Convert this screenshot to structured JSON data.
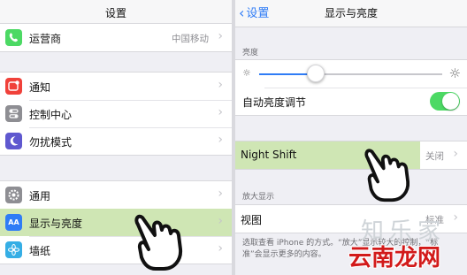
{
  "left": {
    "title": "设置",
    "carrier": {
      "label": "运营商",
      "value": "中国移动"
    },
    "group2": [
      {
        "label": "通知",
        "icon": "notifications-icon",
        "color": "#f0413a"
      },
      {
        "label": "控制中心",
        "icon": "control-center-icon",
        "color": "#8e8e93"
      },
      {
        "label": "勿扰模式",
        "icon": "moon-icon",
        "color": "#5f58cf"
      }
    ],
    "group3": [
      {
        "label": "通用",
        "icon": "gear-icon",
        "color": "#8e8e93"
      },
      {
        "label": "显示与亮度",
        "icon": "display-brightness-icon",
        "color": "#2f7cf6",
        "glyph": "AA"
      },
      {
        "label": "墙纸",
        "icon": "wallpaper-icon",
        "color": "#35aee5"
      }
    ]
  },
  "right": {
    "back": "设置",
    "title": "显示与亮度",
    "brightness_header": "亮度",
    "brightness_level": 0.31,
    "auto_brightness": {
      "label": "自动亮度调节",
      "on": true
    },
    "night_shift": {
      "label": "Night Shift",
      "value": "关闭"
    },
    "zoom_header": "放大显示",
    "view": {
      "label": "视图",
      "value": "标准"
    },
    "footnote": "选取查看 iPhone 的方式。“放大”显示较大的控制，“标准”会显示更多的内容。"
  },
  "watermark": {
    "faint": "知乐家",
    "main": "云南龙网"
  },
  "colors": {
    "accent": "#2f7cf6",
    "highlight": "#cfe6b4",
    "toggle_on": "#4cd964"
  }
}
